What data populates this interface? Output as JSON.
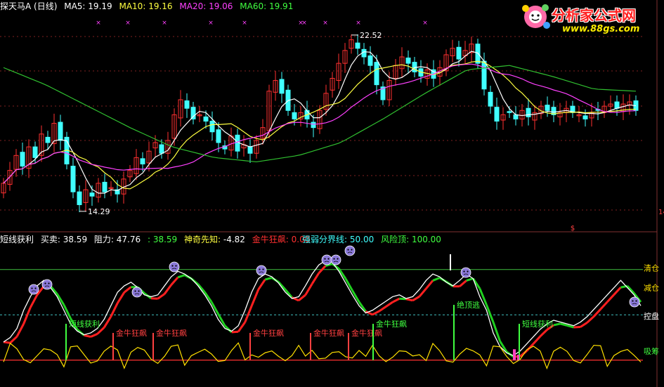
{
  "upper": {
    "title": "探天马A (日线)",
    "ma": [
      {
        "label": "MA5:",
        "value": "19.19",
        "color": "#ffffff"
      },
      {
        "label": "MA10:",
        "value": "19.16",
        "color": "#ffff40"
      },
      {
        "label": "MA20:",
        "value": "19.06",
        "color": "#ff40ff"
      },
      {
        "label": "MA60:",
        "value": "19.91",
        "color": "#40ff40"
      }
    ],
    "high_label": "22.52",
    "low_label": "14.29",
    "right_edge_label": "14"
  },
  "lower": {
    "title": "短线获利",
    "buy_label": "买卖:",
    "buy_value": "38.59",
    "resist_label": "阻力:",
    "resist_value": "47.76",
    "green_value": ": 38.59",
    "shenqi_label": "神奇先知:",
    "shenqi_value": "-4.82",
    "jinniu_label": "金牛狂飙:",
    "jinniu_value": "0.00",
    "qiangruo_label": "强弱分界线:",
    "qiangruo_value": "50.00",
    "risk_label": "风险顶:",
    "risk_value": "100.00",
    "right_labels": [
      "清仓",
      "减仓",
      "控盘",
      "吸筹"
    ],
    "annotations": [
      "短线获利",
      "金牛狂飙",
      "金牛狂飙",
      "金牛狂飙",
      "金牛狂飙",
      "金牛狂飙",
      "金牛狂飙",
      "短线获利",
      "绝顶逃",
      "短线获利"
    ]
  },
  "logo": {
    "text": "分析家公式网",
    "url": "www.88gs.com"
  },
  "colors": {
    "up": "#ff3030",
    "down": "#40ffff",
    "ma5": "#ffffff",
    "ma10": "#ffff40",
    "ma20": "#ff40ff",
    "ma60": "#30c030",
    "grid": "#802020"
  },
  "chart_data": [
    {
      "type": "candlestick",
      "title": "探天马A (日线)",
      "ylim": [
        13.5,
        23.5
      ],
      "marked_high": 22.52,
      "marked_low": 14.29,
      "close": [
        15.6,
        16.2,
        16.9,
        16.4,
        17.3,
        16.8,
        17.9,
        17.5,
        18.4,
        17.6,
        16.5,
        15.2,
        14.6,
        15.3,
        15.0,
        15.6,
        15.2,
        15.4,
        15.1,
        15.8,
        16.2,
        16.8,
        16.5,
        17.1,
        17.5,
        17.0,
        17.6,
        18.8,
        19.5,
        19.1,
        18.6,
        18.8,
        18.5,
        18.0,
        17.5,
        17.2,
        17.8,
        17.1,
        17.4,
        17.0,
        17.6,
        18.2,
        19.9,
        20.4,
        19.8,
        19.0,
        18.6,
        18.9,
        18.6,
        18.2,
        19.0,
        19.8,
        20.5,
        21.2,
        21.8,
        22.3,
        21.9,
        21.5,
        21.1,
        20.2,
        19.5,
        20.4,
        21.1,
        21.5,
        21.2,
        20.8,
        20.6,
        20.9,
        20.5,
        21.0,
        21.6,
        21.9,
        21.4,
        21.8,
        22.1,
        21.2,
        20.0,
        19.2,
        18.5,
        18.8,
        18.9,
        18.6,
        19.0,
        18.7,
        18.9,
        19.2,
        19.0,
        18.8,
        18.9,
        19.1,
        18.9,
        18.8,
        18.6,
        18.9,
        19.0,
        19.2,
        19.3,
        19.1,
        19.3,
        19.4,
        19.0
      ],
      "ma5_label": 19.19,
      "ma10_label": 19.16,
      "ma20_label": 19.06,
      "ma60_label": 19.91
    },
    {
      "type": "line",
      "title": "短线获利",
      "ylim": [
        -25,
        130
      ],
      "reference_lines": {
        "qiangruo": 50,
        "risk": 100
      },
      "white": [
        20,
        25,
        35,
        55,
        70,
        82,
        88,
        80,
        70,
        55,
        40,
        32,
        28,
        30,
        35,
        45,
        60,
        75,
        82,
        86,
        80,
        72,
        70,
        72,
        82,
        92,
        98,
        95,
        90,
        82,
        72,
        60,
        45,
        35,
        32,
        38,
        55,
        75,
        90,
        95,
        92,
        85,
        75,
        68,
        70,
        82,
        95,
        105,
        110,
        108,
        98,
        85,
        72,
        60,
        52,
        55,
        60,
        65,
        70,
        72,
        68,
        70,
        78,
        88,
        95,
        92,
        86,
        82,
        88,
        95,
        90,
        70,
        55,
        30,
        15,
        8,
        5,
        10,
        18,
        26,
        34,
        40,
        44,
        42,
        40,
        38,
        42,
        48,
        56,
        64,
        72,
        80,
        88,
        80,
        72,
        60
      ]
    }
  ]
}
